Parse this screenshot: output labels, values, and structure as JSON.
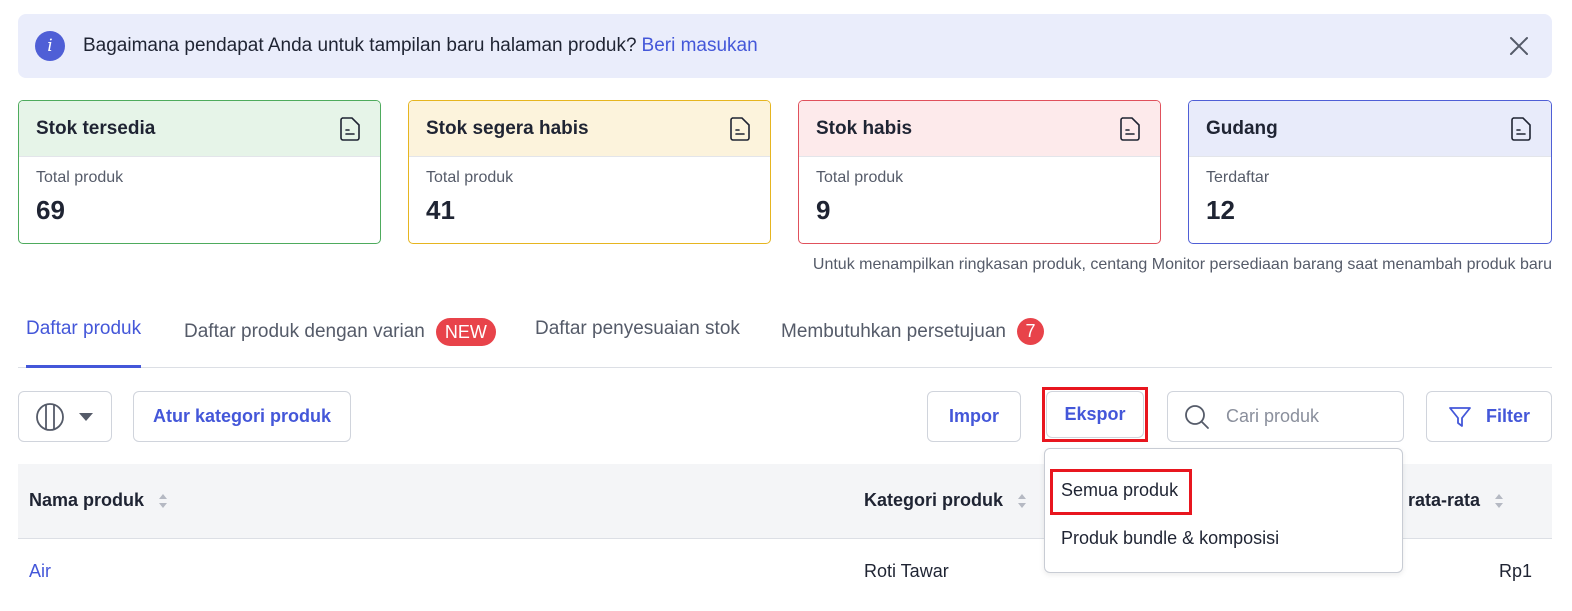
{
  "banner": {
    "text": "Bagaimana pendapat Anda untuk tampilan baru halaman produk?",
    "link": "Beri masukan"
  },
  "cards": [
    {
      "title": "Stok tersedia",
      "label": "Total produk",
      "value": "69",
      "color": "#4eab5d"
    },
    {
      "title": "Stok segera habis",
      "label": "Total produk",
      "value": "41",
      "color": "#e6b520"
    },
    {
      "title": "Stok habis",
      "label": "Total produk",
      "value": "9",
      "color": "#e0515c"
    },
    {
      "title": "Gudang",
      "label": "Terdaftar",
      "value": "12",
      "color": "#4f5fd6"
    }
  ],
  "hint": "Untuk menampilkan ringkasan produk, centang Monitor persediaan barang saat menambah produk baru",
  "tabs": [
    {
      "label": "Daftar produk",
      "active": true
    },
    {
      "label": "Daftar produk dengan varian",
      "badge": "NEW"
    },
    {
      "label": "Daftar penyesuaian stok"
    },
    {
      "label": "Membutuhkan persetujuan",
      "badge": "7"
    }
  ],
  "toolbar": {
    "category_label": "Atur kategori produk",
    "import_label": "Impor",
    "export_label": "Ekspor",
    "search_placeholder": "Cari produk",
    "filter_label": "Filter"
  },
  "table": {
    "columns": [
      "Nama produk",
      "Kategori produk",
      "rata-rata"
    ],
    "rows": [
      {
        "name": "Air",
        "category": "Roti Tawar",
        "avg": "Rp1"
      }
    ]
  },
  "export_menu": {
    "items": [
      "Semua produk",
      "Produk bundle & komposisi"
    ]
  },
  "colors": {
    "accent": "#4457d9",
    "highlight": "#e8161f",
    "badge": "#e8434a"
  }
}
